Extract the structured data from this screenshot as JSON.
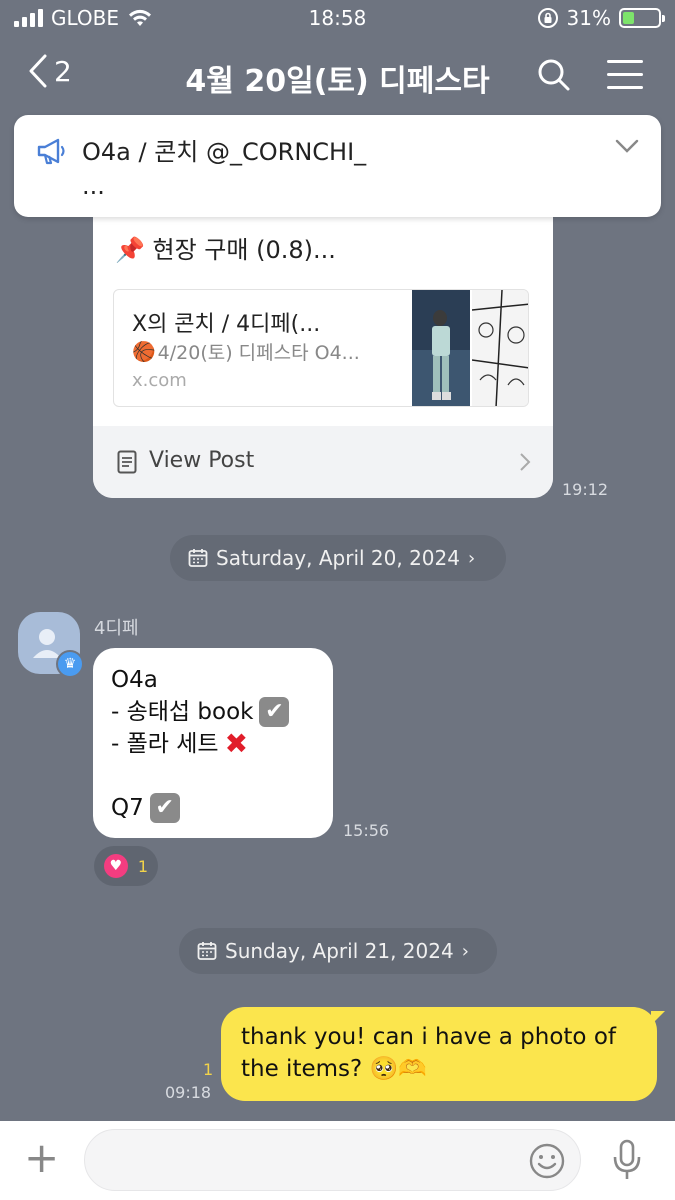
{
  "status_bar": {
    "carrier": "GLOBE",
    "time": "18:58",
    "battery": "31%",
    "battery_level": 0.31
  },
  "header": {
    "back_count": "2",
    "title": "4월 20일(토) 디페스타"
  },
  "announcement": {
    "line1": "O4a / 콘치 @_CORNCHI_",
    "line2": "..."
  },
  "post_card": {
    "pinned_line": "📌 현장 구매 (0.8)...",
    "preview_title": "X의 콘치 / 4디페(...",
    "preview_desc_emoji": "🏀",
    "preview_desc": "4/20(토) 디페스타 O4...",
    "preview_url": "x.com",
    "view_post": "View Post",
    "time": "19:12"
  },
  "date_dividers": [
    {
      "label": "Saturday, April 20, 2024"
    },
    {
      "label": "Sunday, April 21, 2024"
    }
  ],
  "received_message": {
    "sender": "4디페",
    "lines": [
      "O4a",
      "- 송태섭 book",
      "- 폴라 세트",
      "",
      "Q7"
    ],
    "time": "15:56",
    "reaction_count": "1"
  },
  "sent_message": {
    "text_line1": "thank you! can i have a photo of",
    "text_line2": "the items? 🥺🫶",
    "read_count": "1",
    "time": "09:18"
  },
  "colors": {
    "chat_background": "#6e7480",
    "sent_bubble": "#fbe54d",
    "received_bubble": "#ffffff",
    "reaction_heart": "#f33d80"
  }
}
